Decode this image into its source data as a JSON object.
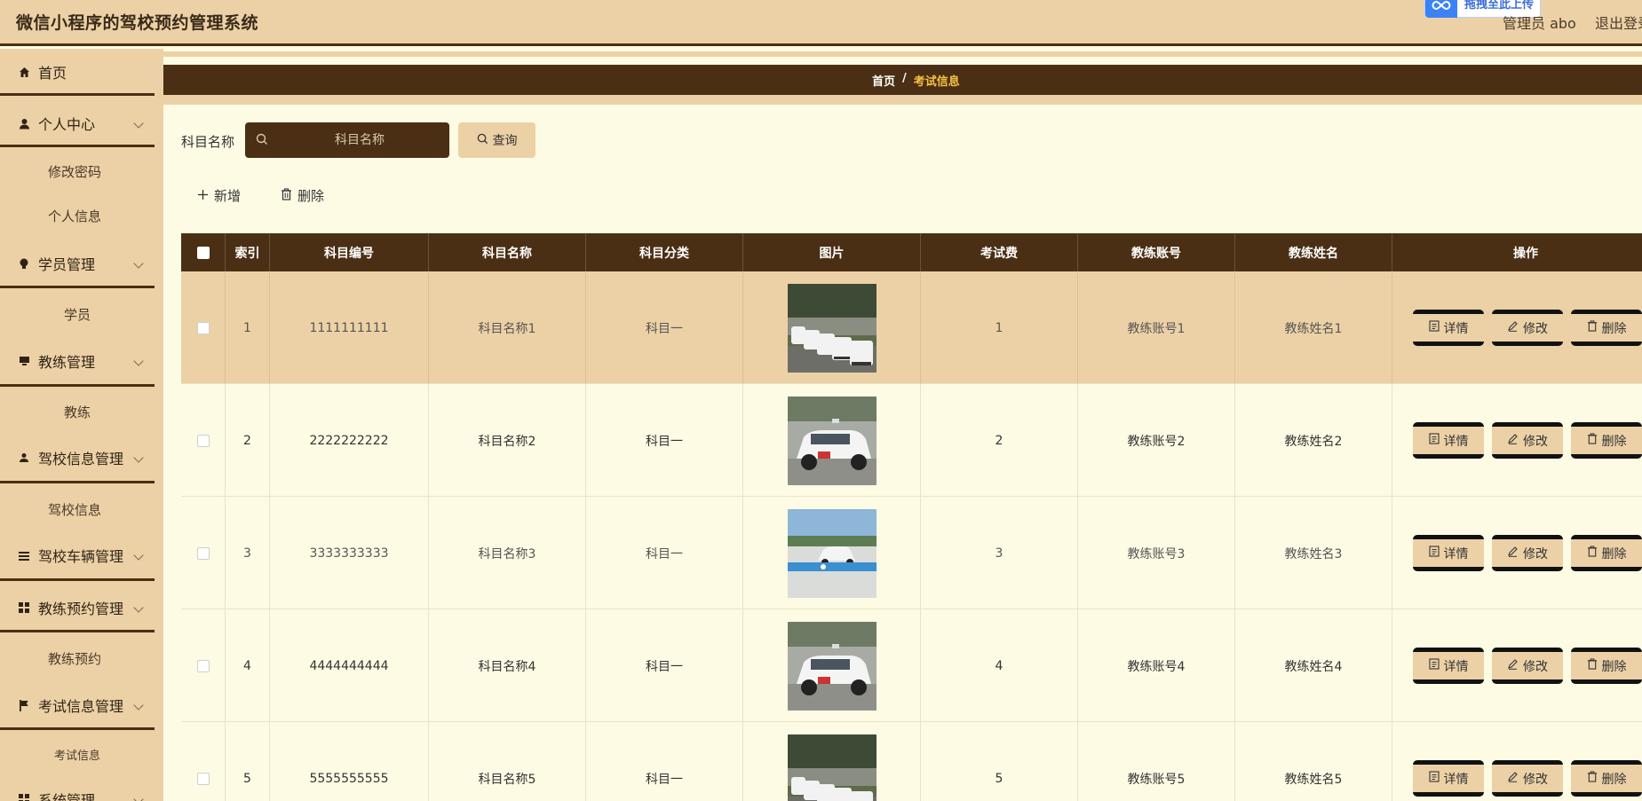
{
  "header": {
    "title": "微信小程序的驾校预约管理系统",
    "upload_badge": "拖拽至此上传",
    "admin": "管理员 abo",
    "logout": "退出登录"
  },
  "sidebar": {
    "items": [
      {
        "label": "首页",
        "icon": "home-icon"
      },
      {
        "label": "个人中心",
        "icon": "user-icon"
      },
      {
        "label": "修改密码"
      },
      {
        "label": "个人信息"
      },
      {
        "label": "学员管理",
        "icon": "bulb-icon"
      },
      {
        "label": "学员"
      },
      {
        "label": "教练管理",
        "icon": "monitor-icon"
      },
      {
        "label": "教练"
      },
      {
        "label": "驾校信息管理",
        "icon": "person-icon"
      },
      {
        "label": "驾校信息"
      },
      {
        "label": "驾校车辆管理",
        "icon": "list-icon"
      },
      {
        "label": "教练预约管理",
        "icon": "grid-icon"
      },
      {
        "label": "教练预约"
      },
      {
        "label": "考试信息管理",
        "icon": "flag-icon"
      },
      {
        "label": "考试信息"
      },
      {
        "label": "系统管理",
        "icon": "grid-icon"
      }
    ]
  },
  "breadcrumb": {
    "home": "首页",
    "sep": "/",
    "current": "考试信息"
  },
  "search": {
    "label": "科目名称",
    "placeholder": "科目名称",
    "button": "查询"
  },
  "actions": {
    "add": "新增",
    "delete": "删除"
  },
  "table": {
    "headers": [
      "索引",
      "科目编号",
      "科目名称",
      "科目分类",
      "图片",
      "考试费",
      "教练账号",
      "教练姓名",
      "操作"
    ],
    "op_labels": {
      "detail": "详情",
      "edit": "修改",
      "delete": "删除"
    },
    "rows": [
      {
        "index": "1",
        "code": "1111111111",
        "name": "科目名称1",
        "category": "科目一",
        "fee": "1",
        "account": "教练账号1",
        "coach": "教练姓名1"
      },
      {
        "index": "2",
        "code": "2222222222",
        "name": "科目名称2",
        "category": "科目一",
        "fee": "2",
        "account": "教练账号2",
        "coach": "教练姓名2"
      },
      {
        "index": "3",
        "code": "3333333333",
        "name": "科目名称3",
        "category": "科目一",
        "fee": "3",
        "account": "教练账号3",
        "coach": "教练姓名3"
      },
      {
        "index": "4",
        "code": "4444444444",
        "name": "科目名称4",
        "category": "科目一",
        "fee": "4",
        "account": "教练账号4",
        "coach": "教练姓名4"
      },
      {
        "index": "5",
        "code": "5555555555",
        "name": "科目名称5",
        "category": "科目一",
        "fee": "5",
        "account": "教练账号5",
        "coach": "教练姓名5"
      }
    ]
  },
  "colors": {
    "brand_dark": "#4a2f14",
    "tan": "#ecd1a6",
    "cream": "#fdfbe3",
    "crumb_active": "#f5c242"
  }
}
